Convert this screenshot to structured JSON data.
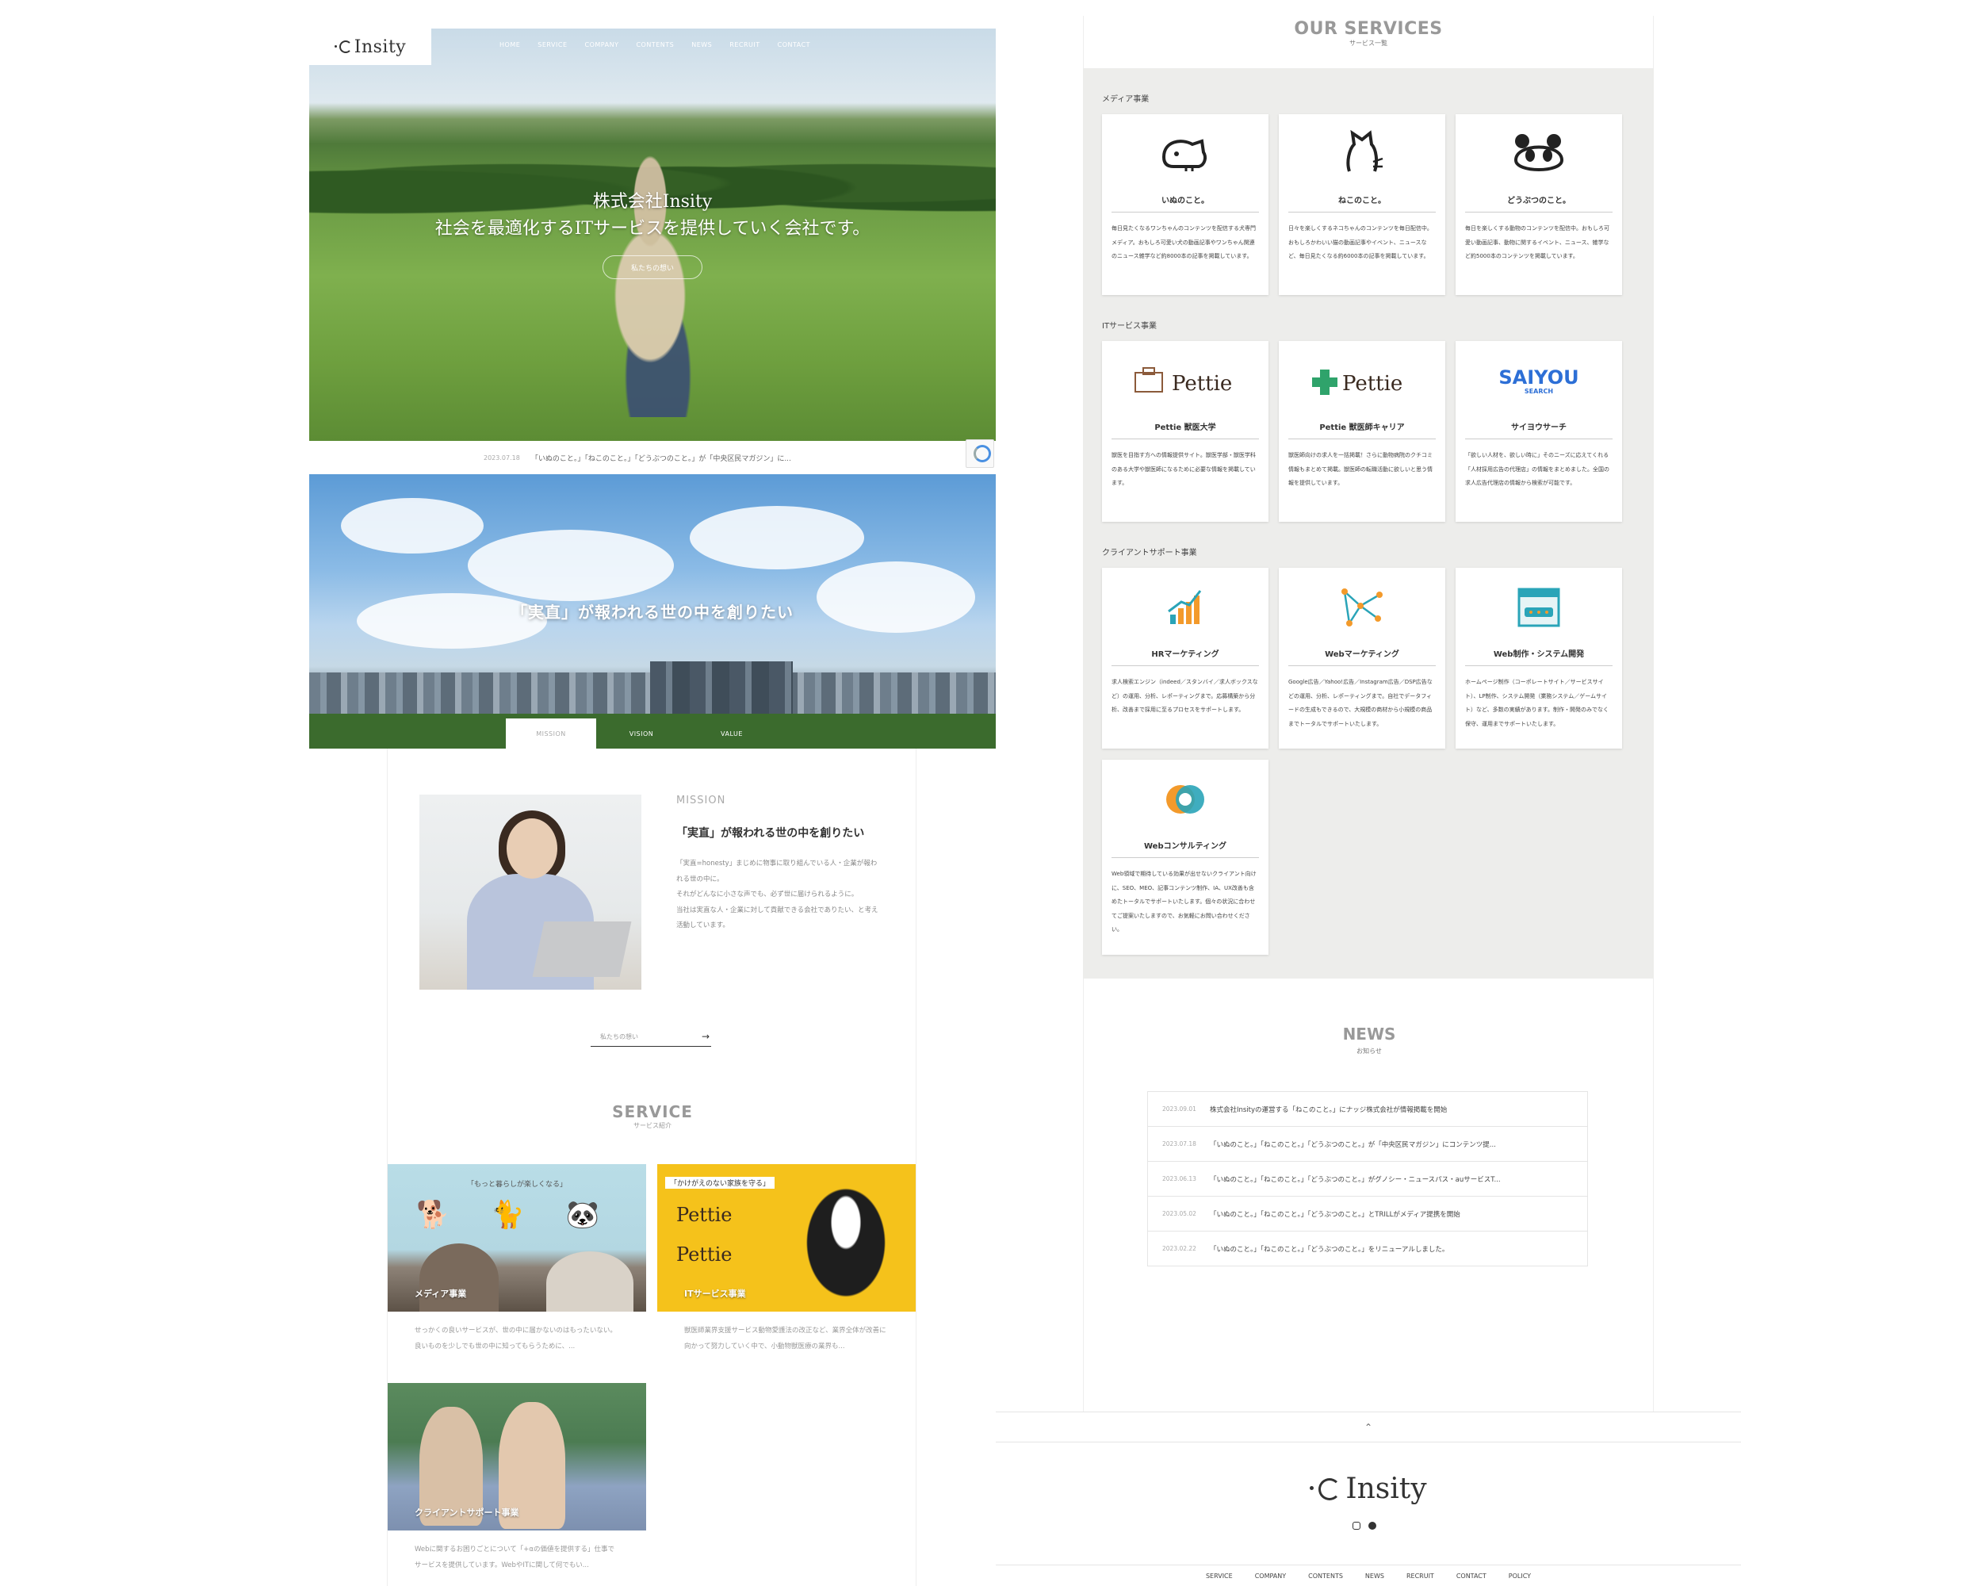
{
  "hero": {
    "logo": "Insity",
    "nav": [
      "HOME",
      "SERVICE",
      "COMPANY",
      "CONTENTS",
      "NEWS",
      "RECRUIT",
      "CONTACT"
    ],
    "copy_line1": "株式会社Insity",
    "copy_line2": "社会を最適化するITサービスを提供していく会社です。",
    "button": "私たちの想い"
  },
  "news_strip": {
    "date": "2023.07.18",
    "text": "「いぬのこと。」「ねこのこと。」「どうぶつのこと。」が「中央区民マガジン」に..."
  },
  "sky": {
    "title": "「実直」が報われる世の中を創りたい",
    "tabs": [
      "MISSION",
      "VISION",
      "VALUE"
    ]
  },
  "mission": {
    "label": "MISSION",
    "title": "「実直」が報われる世の中を創りたい",
    "body": "「実直=honesty」まじめに物事に取り組んでいる人・企業が報われる世の中に。\nそれがどんなに小さな声でも、必ず世に届けられるように。\n当社は実直な人・企業に対して貢献できる会社でありたい、と考え活動しています。",
    "link": "私たちの想い",
    "arrow": "→"
  },
  "service": {
    "en": "SERVICE",
    "jp": "サービス紹介",
    "cards": [
      {
        "caption": "メディア事業",
        "tagline": "「もっと暮らしが楽しくなる」",
        "desc": "せっかくの良いサービスが、世の中に届かないのはもったいない。良いものを少しでも世の中に知ってもらうために、..."
      },
      {
        "caption": "ITサービス事業",
        "tagline": "「かけがえのない家族を守る」",
        "brand1": "Pettie",
        "brand2": "Pettie",
        "desc": "獣医師業界支援サービス動物愛護法の改正など、業界全体が改善に向かって努力していく中で、小動物獣医療の業界も..."
      },
      {
        "caption": "クライアントサポート事業",
        "desc": "Webに関するお困りごとについて「+αの価値を提供する」仕事でサービスを提供しています。WebやITに関して何でもい..."
      }
    ]
  },
  "our_services": {
    "en": "OUR SERVICES",
    "jp": "サービス一覧",
    "categories": [
      {
        "label": "メディア事業",
        "items": [
          {
            "title": "いぬのこと。",
            "icon": "dog-line-icon",
            "text": "毎日見たくなるワンちゃんのコンテンツを配信する犬専門メディア。おもしろ可愛い犬の動画記事やワンちゃん関連のニュース雑学など約8000本の記事を掲載しています。"
          },
          {
            "title": "ねこのこと。",
            "icon": "cat-line-icon",
            "text": "日々を楽しくするネコちゃんのコンテンツを毎日配信中。おもしろかわいい猫の動画記事やイベント、ニュースなど、毎日見たくなる約6000本の記事を掲載しています。"
          },
          {
            "title": "どうぶつのこと。",
            "icon": "panda-line-icon",
            "text": "毎日を楽しくする動物のコンテンツを配信中。おもしろ可愛い動画記事、動物に関するイベント、ニュース、雑学など約5000本のコンテンツを掲載しています。"
          }
        ]
      },
      {
        "label": "ITサービス事業",
        "items": [
          {
            "title": "Pettie 獣医大学",
            "logo": "Pettie",
            "icon": "pettie-university-logo",
            "text": "獣医を目指す方への情報提供サイト。獣医学部・獣医学科のある大学や獣医師になるために必要な情報を掲載しています。"
          },
          {
            "title": "Pettie 獣医師キャリア",
            "logo": "Pettie",
            "icon": "pettie-career-logo",
            "text": "獣医師向けの求人を一括掲載！さらに動物病院のクチコミ情報もまとめて掲載。獣医師の転職活動に欲しいと思う情報を提供しています。"
          },
          {
            "title": "サイヨウサーチ",
            "logo": "SAIYOU",
            "logo_sub": "SEARCH",
            "icon": "saiyou-search-logo",
            "text": "「欲しい人材を、欲しい時に」そのニーズに応えてくれる「人材採用広告の代理店」の情報をまとめました。全国の求人広告代理店の情報から検索が可能です。"
          }
        ]
      },
      {
        "label": "クライアントサポート事業",
        "items": [
          {
            "title": "HRマーケティング",
            "icon": "bar-chart-icon",
            "text": "求人検索エンジン（indeed／スタンバイ／求人ボックスなど）の運用、分析、レポーティングまで。応募構築から分析、改善まで採用に至るプロセスをサポートします。"
          },
          {
            "title": "Webマーケティング",
            "icon": "network-nodes-icon",
            "text": "Google広告／Yahoo!広告／Instagram広告／DSP広告などの運用、分析、レポーティングまで。自社でデータフィードの生成もできるので、大規模の商材から小規模の商品までトータルでサポートいたします。"
          },
          {
            "title": "Web制作・システム開発",
            "icon": "browser-window-icon",
            "text": "ホームページ制作（コーポレートサイト／サービスサイト）、LP制作、システム開発（業務システム／ゲームサイト）など、多数の実績があります。制作・開発のみでなく保守、運用までサポートいたします。"
          }
        ]
      },
      {
        "label": "",
        "items": [
          {
            "title": "Webコンサルティング",
            "icon": "consulting-loop-icon",
            "text": "Web領域で期待している効果が出せないクライアント向けに、SEO、MEO、記事コンテンツ制作、IA、UX改善も含めたトータルでサポートいたします。個々の状況に合わせてご提案いたしますので、お気軽にお問い合わせください。"
          }
        ]
      }
    ]
  },
  "news": {
    "en": "NEWS",
    "jp": "お知らせ",
    "items": [
      {
        "date": "2023.09.01",
        "text": "株式会社Insityの運営する「ねこのこと。」にナッジ株式会社が情報掲載を開始"
      },
      {
        "date": "2023.07.18",
        "text": "「いぬのこと。」「ねこのこと。」「どうぶつのこと。」が「中央区民マガジン」にコンテンツ提..."
      },
      {
        "date": "2023.06.13",
        "text": "「いぬのこと。」「ねこのこと。」「どうぶつのこと。」がグノシー・ニュースパス・auサービスT..."
      },
      {
        "date": "2023.05.02",
        "text": "「いぬのこと。」「ねこのこと。」「どうぶつのこと。」とTRILLがメディア提携を開始"
      },
      {
        "date": "2023.02.22",
        "text": "「いぬのこと。」「ねこのこと。」「どうぶつのこと。」をリニューアルしました。"
      }
    ]
  },
  "footer": {
    "totop": "⌃",
    "logo": "Insity",
    "nav": [
      "SERVICE",
      "COMPANY",
      "CONTENTS",
      "NEWS",
      "RECRUIT",
      "CONTACT",
      "POLICY"
    ]
  },
  "colors": {
    "grey_bg": "#ededeb",
    "it_yellow": "#f5c21b",
    "pettie_green": "#2fa36b",
    "saiyou_blue": "#2d6fd6",
    "accent_orange": "#f39a2b",
    "teal": "#2aa4b8"
  }
}
